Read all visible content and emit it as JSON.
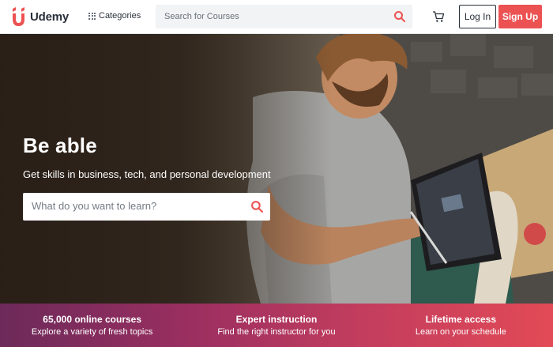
{
  "header": {
    "logo_text": "Udemy",
    "categories_label": "Categories",
    "search_placeholder": "Search for Courses",
    "login_label": "Log In",
    "signup_label": "Sign Up"
  },
  "hero": {
    "title": "Be able",
    "subtitle": "Get skills in business, tech, and personal development",
    "search_placeholder": "What do you want to learn?"
  },
  "features": [
    {
      "title": "65,000 online courses",
      "description": "Explore a variety of fresh topics"
    },
    {
      "title": "Expert instruction",
      "description": "Find the right instructor for you"
    },
    {
      "title": "Lifetime access",
      "description": "Learn on your schedule"
    }
  ],
  "icons": {
    "logo": "udemy-logo-icon",
    "categories": "grid-icon",
    "search": "search-icon",
    "cart": "cart-icon"
  },
  "colors": {
    "brand_red": "#ec5252",
    "header_bg": "#ffffff",
    "text_dark": "#29303b",
    "band_start": "#6c2a5a",
    "band_end": "#e24a56"
  }
}
